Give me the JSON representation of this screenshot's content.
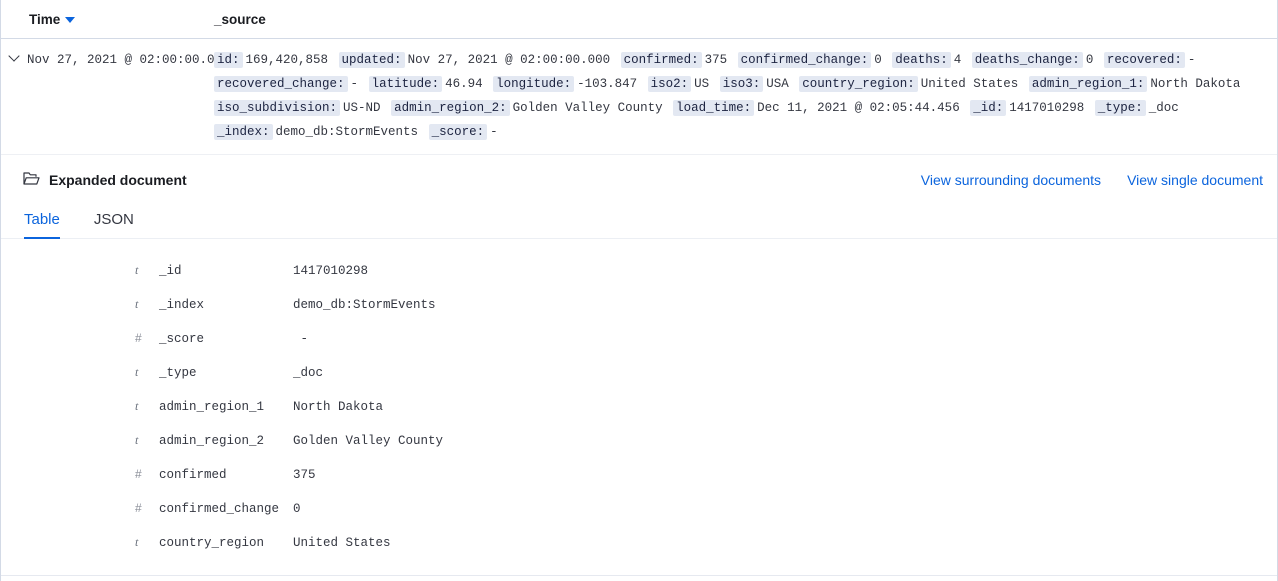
{
  "table": {
    "columns": [
      {
        "label": "Time",
        "sort_icon": "sort-desc-caret"
      },
      {
        "label": "_source"
      }
    ]
  },
  "document_row": {
    "expand_icon": "chevron-down-icon",
    "time": "Nov 27, 2021 @ 02:00:00.000",
    "source_fields": [
      {
        "key": "id:",
        "value": "169,420,858"
      },
      {
        "key": "updated:",
        "value": "Nov 27, 2021 @ 02:00:00.000"
      },
      {
        "key": "confirmed:",
        "value": "375"
      },
      {
        "key": "confirmed_change:",
        "value": "0"
      },
      {
        "key": "deaths:",
        "value": "4"
      },
      {
        "key": "deaths_change:",
        "value": "0"
      },
      {
        "key": "recovered:",
        "value": "-"
      },
      {
        "key": "recovered_change:",
        "value": "-"
      },
      {
        "key": "latitude:",
        "value": "46.94"
      },
      {
        "key": "longitude:",
        "value": "-103.847"
      },
      {
        "key": "iso2:",
        "value": "US"
      },
      {
        "key": "iso3:",
        "value": "USA"
      },
      {
        "key": "country_region:",
        "value": "United States"
      },
      {
        "key": "admin_region_1:",
        "value": "North Dakota"
      },
      {
        "key": "iso_subdivision:",
        "value": "US-ND"
      },
      {
        "key": "admin_region_2:",
        "value": "Golden Valley County"
      },
      {
        "key": "load_time:",
        "value": "Dec 11, 2021 @ 02:05:44.456"
      },
      {
        "key": "_id:",
        "value": "1417010298"
      },
      {
        "key": "_type:",
        "value": "_doc"
      },
      {
        "key": "_index:",
        "value": "demo_db:StormEvents"
      },
      {
        "key": "_score:",
        "value": "-"
      }
    ]
  },
  "expanded_document": {
    "folder_icon": "folder-open-icon",
    "title": "Expanded document",
    "links": [
      {
        "label": "View surrounding documents"
      },
      {
        "label": "View single document"
      }
    ],
    "tabs": [
      {
        "label": "Table",
        "active": true
      },
      {
        "label": "JSON",
        "active": false
      }
    ],
    "fields": [
      {
        "type": "t",
        "name": "_id",
        "value": "1417010298"
      },
      {
        "type": "t",
        "name": "_index",
        "value": "demo_db:StormEvents"
      },
      {
        "type": "#",
        "name": "_score",
        "value": " -"
      },
      {
        "type": "t",
        "name": "_type",
        "value": "_doc"
      },
      {
        "type": "t",
        "name": "admin_region_1",
        "value": "North Dakota"
      },
      {
        "type": "t",
        "name": "admin_region_2",
        "value": "Golden Valley County"
      },
      {
        "type": "#",
        "name": "confirmed",
        "value": "375"
      },
      {
        "type": "#",
        "name": "confirmed_change",
        "value": "0"
      },
      {
        "type": "t",
        "name": "country_region",
        "value": "United States"
      }
    ]
  },
  "colors": {
    "accent": "#0b64dd",
    "key_badge_bg": "#e3e8f2",
    "text": "#343741",
    "border": "#d3dae6"
  }
}
